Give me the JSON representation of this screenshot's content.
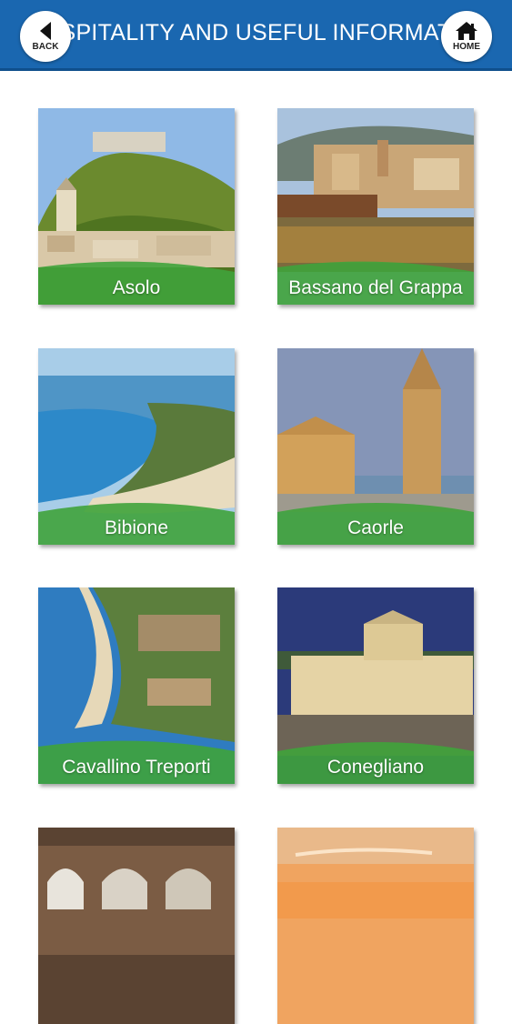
{
  "header": {
    "title": "SPITALITY AND USEFUL INFORMAT",
    "back_label": "BACK",
    "home_label": "HOME",
    "color": "#1a67b0"
  },
  "tiles": [
    {
      "label": "Asolo"
    },
    {
      "label": "Bassano del Grappa"
    },
    {
      "label": "Bibione"
    },
    {
      "label": "Caorle"
    },
    {
      "label": "Cavallino Treporti"
    },
    {
      "label": "Conegliano"
    },
    {
      "label": ""
    },
    {
      "label": ""
    }
  ],
  "accent_green": "#3fa33b"
}
